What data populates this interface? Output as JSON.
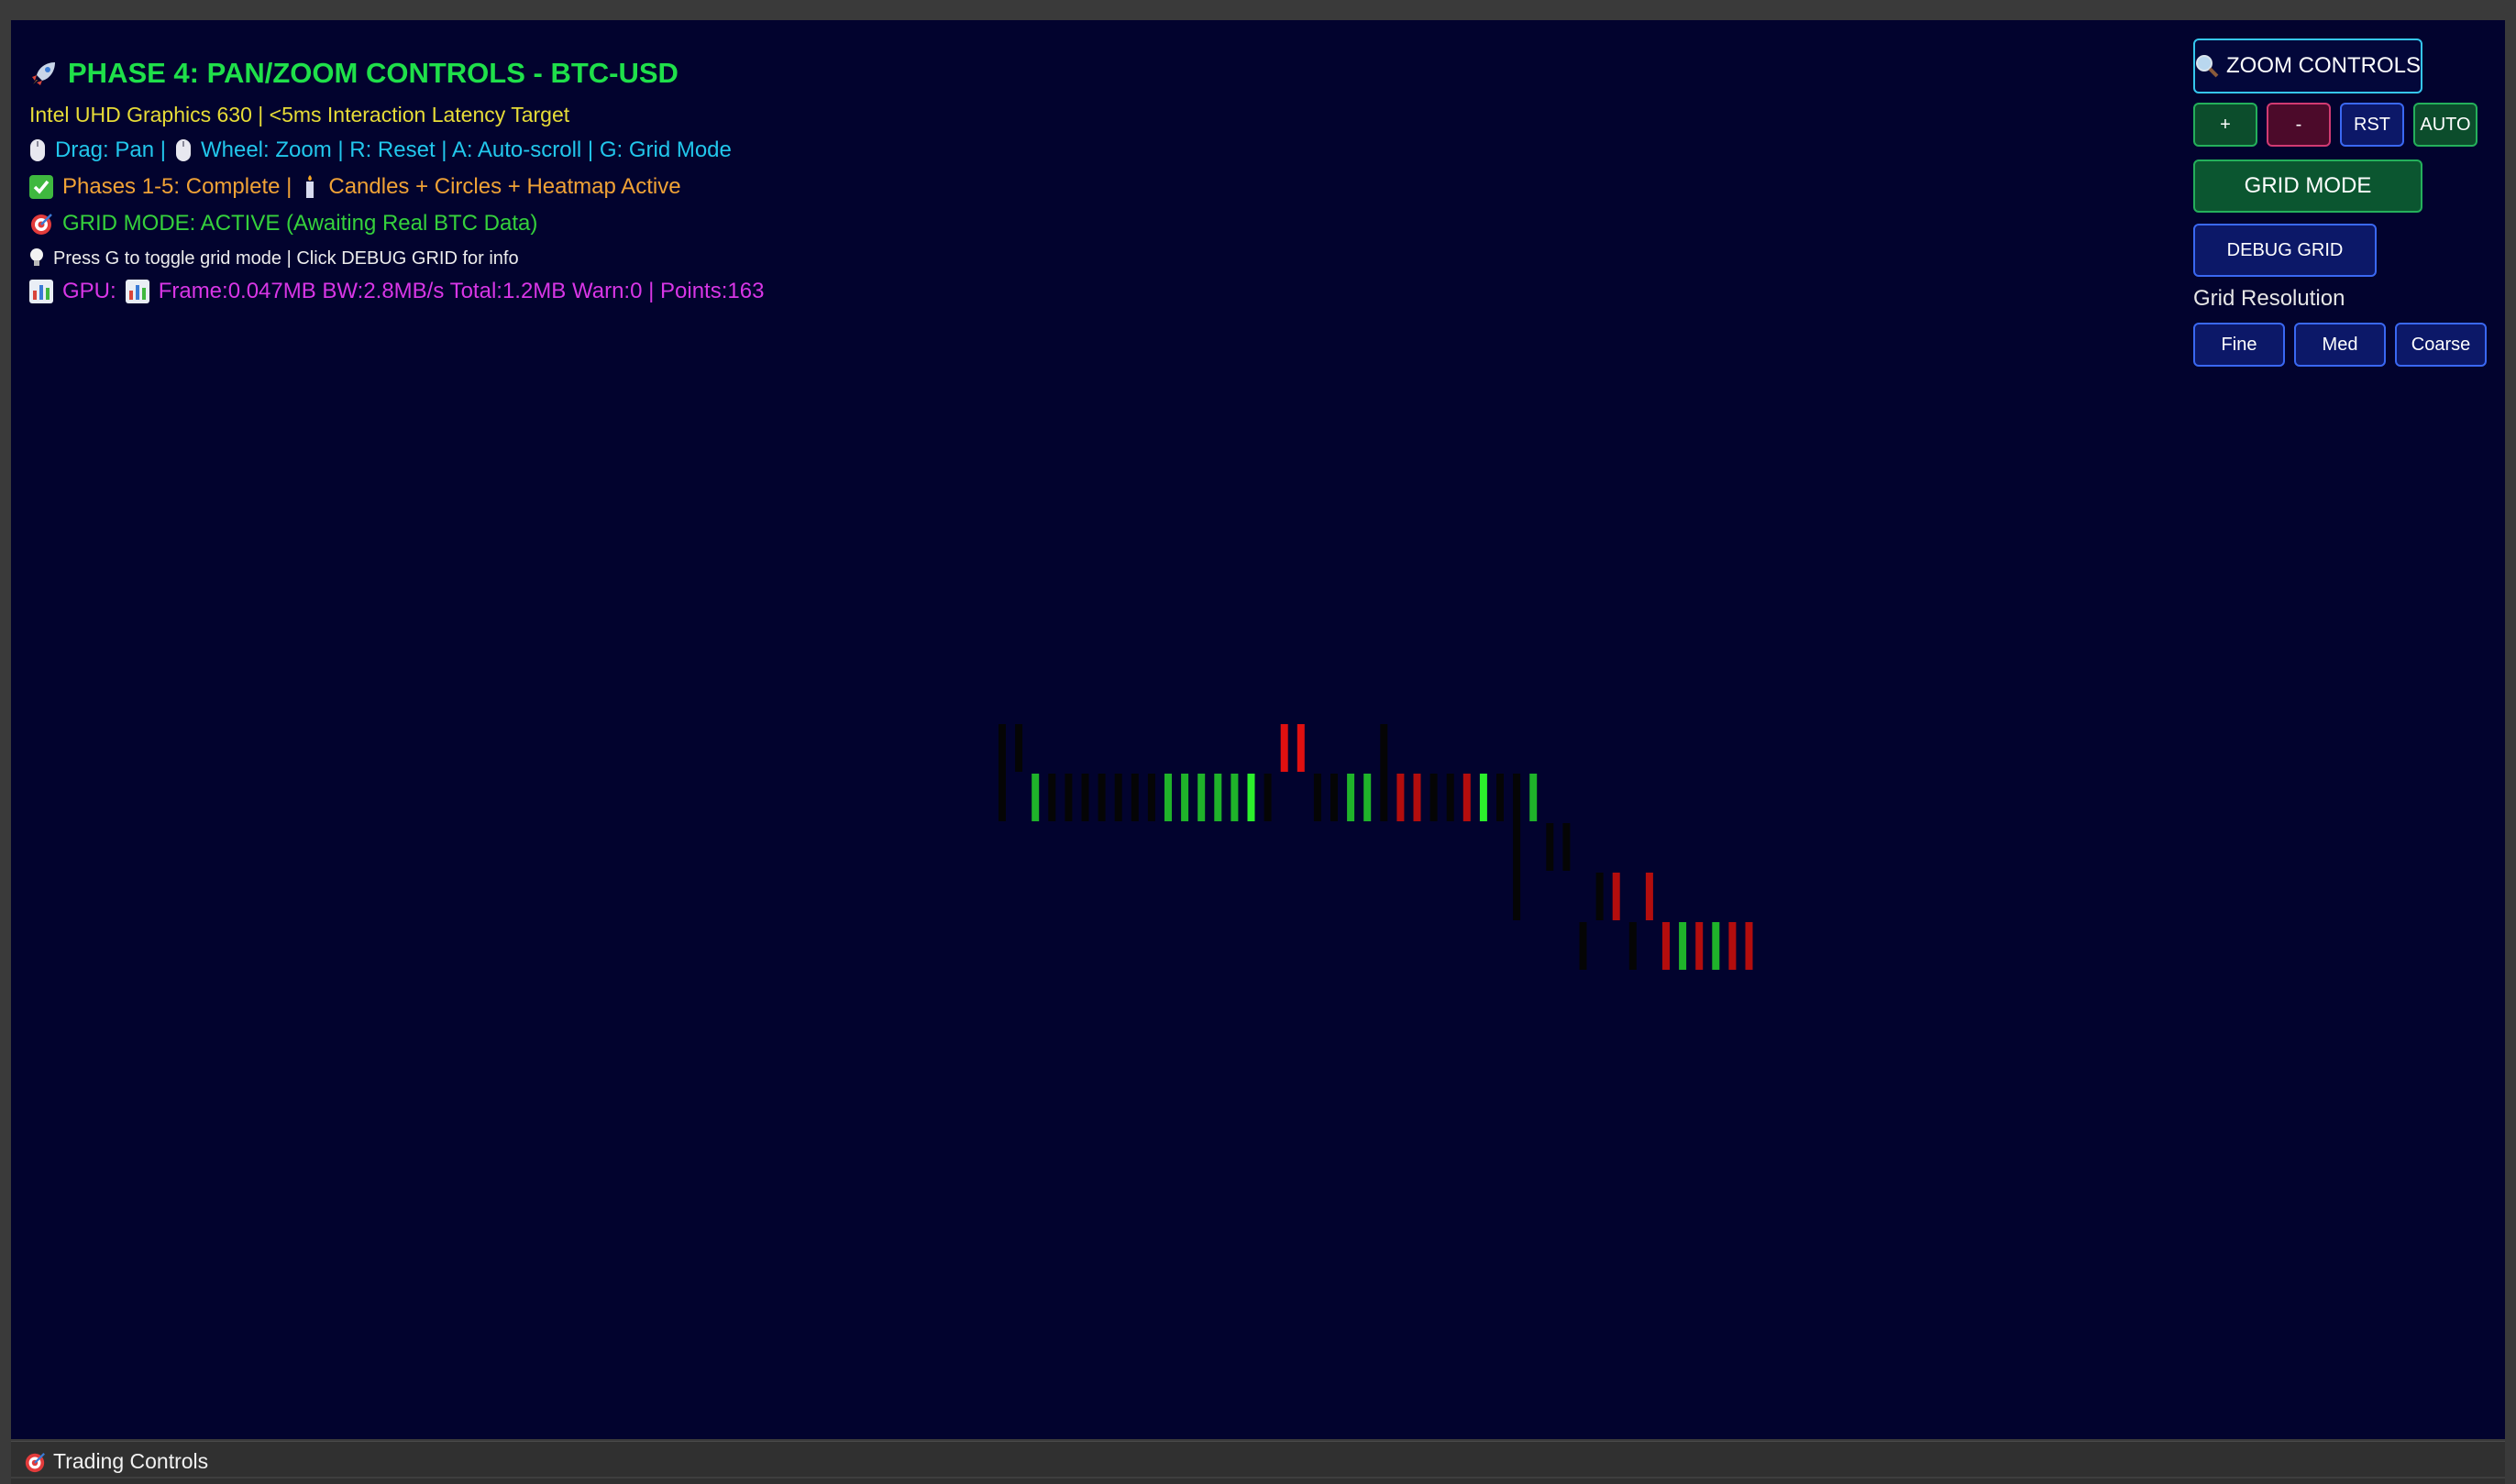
{
  "header": {
    "title": "PHASE 4: PAN/ZOOM CONTROLS - BTC-USD",
    "subtitle": "Intel UHD Graphics 630 | <5ms Interaction Latency Target",
    "controls_hint_a": "Drag: Pan |",
    "controls_hint_b": "Wheel: Zoom | R: Reset | A: Auto-scroll | G: Grid Mode",
    "phases_a": "Phases 1-5: Complete |",
    "phases_b": "Candles + Circles + Heatmap Active",
    "grid_status": "GRID MODE: ACTIVE (Awaiting Real BTC Data)",
    "tip": "Press G to toggle grid mode | Click DEBUG GRID for info",
    "gpu_label": "GPU:",
    "gpu_stats": "Frame:0.047MB BW:2.8MB/s Total:1.2MB Warn:0 | Points:163"
  },
  "icons": {
    "title": "rocket-icon",
    "drag": "mouse-icon",
    "wheel": "mouse-icon",
    "phases": "check-mark-icon",
    "candles": "candle-icon",
    "grid_status": "target-icon",
    "tip": "lightbulb-icon",
    "gpu": "bar-chart-icon",
    "zoom": "magnifier-icon",
    "trading": "target-icon"
  },
  "panel": {
    "zoom_controls": "ZOOM CONTROLS",
    "zoom_in": "+",
    "zoom_out": "-",
    "reset": "RST",
    "auto": "AUTO",
    "grid_mode": "GRID MODE",
    "debug_grid": "DEBUG GRID",
    "grid_resolution_label": "Grid Resolution",
    "res_fine": "Fine",
    "res_med": "Med",
    "res_coarse": "Coarse"
  },
  "colors": {
    "background": "#02032e",
    "title": "#1fe04a",
    "subtitle": "#e7dc37",
    "hint": "#22c7ec",
    "phases": "#f0a236",
    "grid_status": "#35d13c",
    "gpu": "#d836e6",
    "bull": "#1fb32a",
    "bull_bright": "#2cf02c",
    "bear": "#b30d0d",
    "bear_bright": "#e01010",
    "neutral": "#050505"
  },
  "bottom_bar": {
    "label": "Trading Controls"
  },
  "chart_data": {
    "type": "heatmap",
    "note_levels": "cells are ordered by time column and price row (row 0 = top)",
    "cells": [
      {
        "col": 0,
        "row": 0,
        "span": 2,
        "kind": "neutral"
      },
      {
        "col": 1,
        "row": 0,
        "span": 1,
        "kind": "neutral"
      },
      {
        "col": 2,
        "row": 1,
        "span": 1,
        "kind": "bull"
      },
      {
        "col": 3,
        "row": 1,
        "span": 1,
        "kind": "neutral"
      },
      {
        "col": 4,
        "row": 1,
        "span": 1,
        "kind": "neutral"
      },
      {
        "col": 5,
        "row": 1,
        "span": 1,
        "kind": "neutral"
      },
      {
        "col": 6,
        "row": 1,
        "span": 1,
        "kind": "neutral"
      },
      {
        "col": 7,
        "row": 1,
        "span": 1,
        "kind": "neutral"
      },
      {
        "col": 8,
        "row": 1,
        "span": 1,
        "kind": "neutral"
      },
      {
        "col": 9,
        "row": 1,
        "span": 1,
        "kind": "neutral"
      },
      {
        "col": 10,
        "row": 1,
        "span": 1,
        "kind": "bull"
      },
      {
        "col": 11,
        "row": 1,
        "span": 1,
        "kind": "bull"
      },
      {
        "col": 12,
        "row": 1,
        "span": 1,
        "kind": "bull"
      },
      {
        "col": 13,
        "row": 1,
        "span": 1,
        "kind": "bull"
      },
      {
        "col": 14,
        "row": 1,
        "span": 1,
        "kind": "bull"
      },
      {
        "col": 15,
        "row": 1,
        "span": 1,
        "kind": "bull_bright"
      },
      {
        "col": 16,
        "row": 1,
        "span": 1,
        "kind": "neutral"
      },
      {
        "col": 17,
        "row": 0,
        "span": 1,
        "kind": "bear_bright"
      },
      {
        "col": 18,
        "row": 0,
        "span": 1,
        "kind": "bear_bright"
      },
      {
        "col": 19,
        "row": 1,
        "span": 1,
        "kind": "neutral"
      },
      {
        "col": 20,
        "row": 1,
        "span": 1,
        "kind": "neutral"
      },
      {
        "col": 21,
        "row": 1,
        "span": 1,
        "kind": "bull"
      },
      {
        "col": 22,
        "row": 1,
        "span": 1,
        "kind": "bull"
      },
      {
        "col": 23,
        "row": 0,
        "span": 2,
        "kind": "neutral"
      },
      {
        "col": 24,
        "row": 1,
        "span": 1,
        "kind": "bear"
      },
      {
        "col": 25,
        "row": 1,
        "span": 1,
        "kind": "bear"
      },
      {
        "col": 26,
        "row": 1,
        "span": 1,
        "kind": "neutral"
      },
      {
        "col": 27,
        "row": 1,
        "span": 1,
        "kind": "neutral"
      },
      {
        "col": 28,
        "row": 1,
        "span": 1,
        "kind": "bear"
      },
      {
        "col": 29,
        "row": 1,
        "span": 1,
        "kind": "bull_bright"
      },
      {
        "col": 30,
        "row": 1,
        "span": 1,
        "kind": "neutral"
      },
      {
        "col": 31,
        "row": 1,
        "span": 3,
        "kind": "neutral"
      },
      {
        "col": 32,
        "row": 1,
        "span": 1,
        "kind": "bull"
      },
      {
        "col": 33,
        "row": 2,
        "span": 1,
        "kind": "neutral"
      },
      {
        "col": 34,
        "row": 2,
        "span": 1,
        "kind": "neutral"
      },
      {
        "col": 35,
        "row": 4,
        "span": 1,
        "kind": "neutral"
      },
      {
        "col": 36,
        "row": 3,
        "span": 1,
        "kind": "neutral"
      },
      {
        "col": 37,
        "row": 3,
        "span": 1,
        "kind": "bear"
      },
      {
        "col": 38,
        "row": 4,
        "span": 1,
        "kind": "neutral"
      },
      {
        "col": 39,
        "row": 3,
        "span": 1,
        "kind": "bear"
      },
      {
        "col": 40,
        "row": 4,
        "span": 1,
        "kind": "bear"
      },
      {
        "col": 41,
        "row": 4,
        "span": 1,
        "kind": "bull"
      },
      {
        "col": 42,
        "row": 4,
        "span": 1,
        "kind": "bear"
      },
      {
        "col": 43,
        "row": 4,
        "span": 1,
        "kind": "bull"
      },
      {
        "col": 44,
        "row": 4,
        "span": 1,
        "kind": "bear"
      },
      {
        "col": 45,
        "row": 4,
        "span": 1,
        "kind": "bear"
      }
    ]
  }
}
